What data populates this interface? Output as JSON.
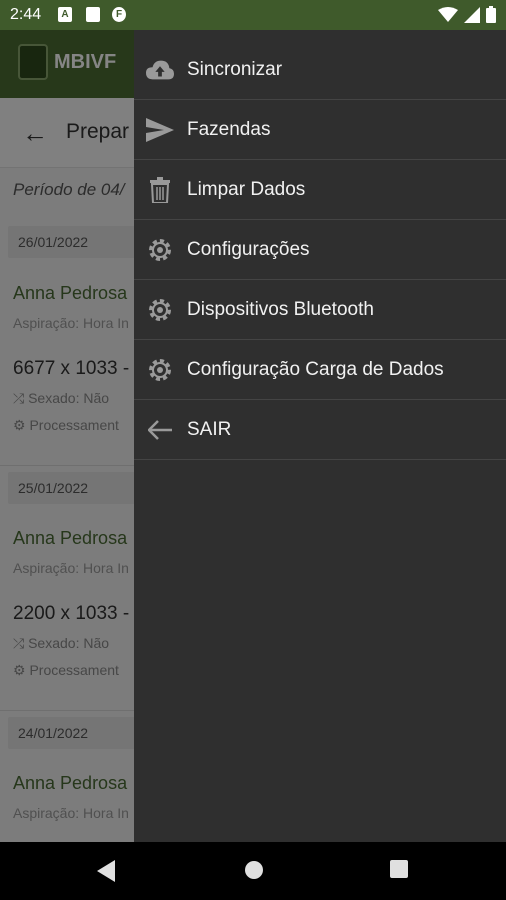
{
  "status_bar": {
    "time": "2:44"
  },
  "app": {
    "logo_text": "MBIVF",
    "subheader_title": "Prepar",
    "period_text": "Período de 04/",
    "groups": [
      {
        "date": "26/01/2022",
        "name": "Anna Pedrosa",
        "sub": "Aspiração: Hora In",
        "code": "6677 x 1033 -",
        "sexado": "Sexado:  Não",
        "proc": "Processament"
      },
      {
        "date": "25/01/2022",
        "name": "Anna Pedrosa",
        "sub": "Aspiração: Hora In",
        "code": "2200 x 1033 -",
        "sexado": "Sexado:  Não",
        "proc": "Processament"
      },
      {
        "date": "24/01/2022",
        "name": "Anna Pedrosa",
        "sub": "Aspiração: Hora In"
      }
    ]
  },
  "drawer": {
    "items": [
      {
        "label": "Sincronizar",
        "icon": "cloud-upload-icon"
      },
      {
        "label": "Fazendas",
        "icon": "send-icon"
      },
      {
        "label": "Limpar Dados",
        "icon": "trash-icon"
      },
      {
        "label": "Configurações",
        "icon": "gear-icon"
      },
      {
        "label": "Dispositivos Bluetooth",
        "icon": "gear-icon"
      },
      {
        "label": "Configuração Carga de Dados",
        "icon": "gear-icon"
      },
      {
        "label": "SAIR",
        "icon": "arrow-left-icon"
      }
    ]
  }
}
